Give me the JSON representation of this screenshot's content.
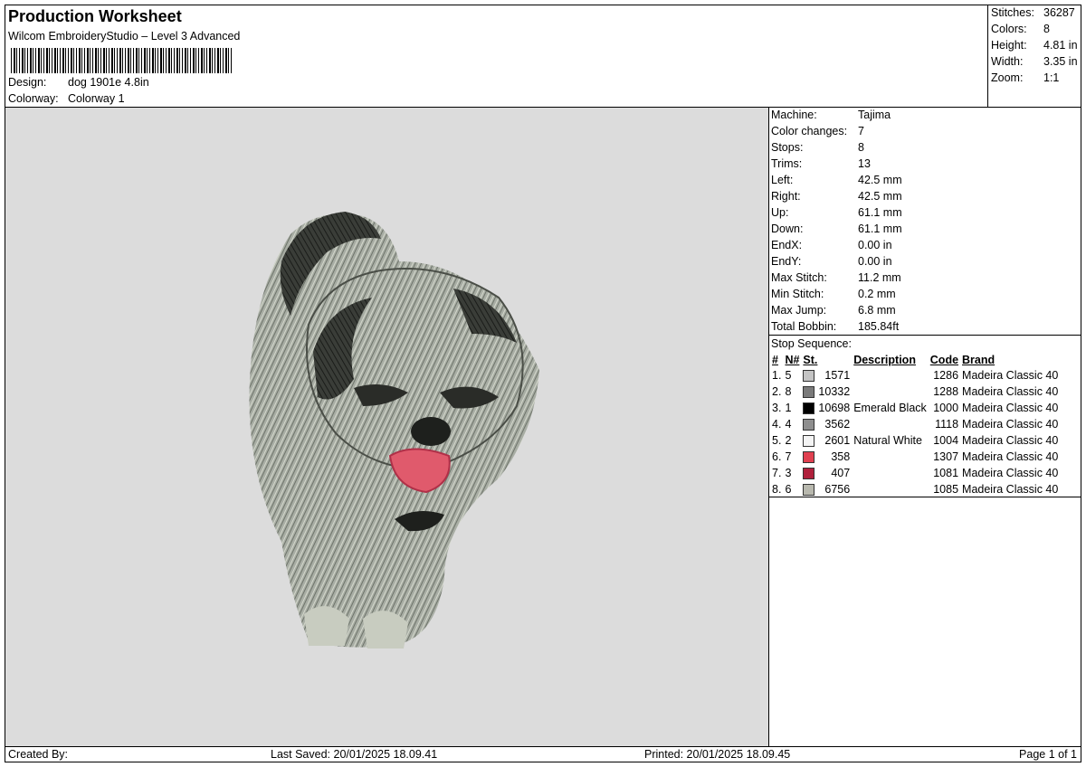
{
  "header": {
    "title": "Production Worksheet",
    "subtitle": "Wilcom EmbroideryStudio – Level 3 Advanced",
    "design_label": "Design:",
    "design_value": "dog 1901e 4.8in",
    "colorway_label": "Colorway:",
    "colorway_value": "Colorway 1"
  },
  "summary": [
    {
      "label": "Stitches:",
      "value": "36287"
    },
    {
      "label": "Colors:",
      "value": "8"
    },
    {
      "label": "Height:",
      "value": "4.81 in"
    },
    {
      "label": "Width:",
      "value": "3.35 in"
    },
    {
      "label": "Zoom:",
      "value": "1:1"
    }
  ],
  "details": [
    {
      "label": "Machine:",
      "value": "Tajima"
    },
    {
      "label": "Color changes:",
      "value": "7"
    },
    {
      "label": "Stops:",
      "value": "8"
    },
    {
      "label": "Trims:",
      "value": "13"
    },
    {
      "label": "Left:",
      "value": "42.5 mm"
    },
    {
      "label": "Right:",
      "value": "42.5 mm"
    },
    {
      "label": "Up:",
      "value": "61.1 mm"
    },
    {
      "label": "Down:",
      "value": "61.1 mm"
    },
    {
      "label": "EndX:",
      "value": "0.00 in"
    },
    {
      "label": "EndY:",
      "value": "0.00 in"
    },
    {
      "label": "Max Stitch:",
      "value": "11.2 mm"
    },
    {
      "label": "Min Stitch:",
      "value": "0.2 mm"
    },
    {
      "label": "Max Jump:",
      "value": "6.8 mm"
    },
    {
      "label": "Total Bobbin:",
      "value": "185.84ft"
    }
  ],
  "stop_sequence": {
    "label": "Stop Sequence:",
    "columns": [
      "#",
      "N#",
      "St.",
      "Description",
      "Code",
      "Brand"
    ],
    "rows": [
      {
        "idx": "1.",
        "n": "5",
        "color": "#c4c4c4",
        "st": "1571",
        "desc": "",
        "code": "1286",
        "brand": "Madeira Classic 40"
      },
      {
        "idx": "2.",
        "n": "8",
        "color": "#7a7a7a",
        "st": "10332",
        "desc": "",
        "code": "1288",
        "brand": "Madeira Classic 40"
      },
      {
        "idx": "3.",
        "n": "1",
        "color": "#000000",
        "st": "10698",
        "desc": "Emerald Black",
        "code": "1000",
        "brand": "Madeira Classic 40"
      },
      {
        "idx": "4.",
        "n": "4",
        "color": "#8e8e8e",
        "st": "3562",
        "desc": "",
        "code": "1118",
        "brand": "Madeira Classic 40"
      },
      {
        "idx": "5.",
        "n": "2",
        "color": "#f4f4f4",
        "st": "2601",
        "desc": "Natural White",
        "code": "1004",
        "brand": "Madeira Classic 40"
      },
      {
        "idx": "6.",
        "n": "7",
        "color": "#e04050",
        "st": "358",
        "desc": "",
        "code": "1307",
        "brand": "Madeira Classic 40"
      },
      {
        "idx": "7.",
        "n": "3",
        "color": "#b0203c",
        "st": "407",
        "desc": "",
        "code": "1081",
        "brand": "Madeira Classic 40"
      },
      {
        "idx": "8.",
        "n": "6",
        "color": "#b8b8ae",
        "st": "6756",
        "desc": "",
        "code": "1085",
        "brand": "Madeira Classic 40"
      }
    ]
  },
  "footer": {
    "created_by": "Created By:",
    "last_saved": "Last Saved: 20/01/2025 18.09.41",
    "printed": "Printed: 20/01/2025 18.09.45",
    "page": "Page 1 of 1"
  }
}
